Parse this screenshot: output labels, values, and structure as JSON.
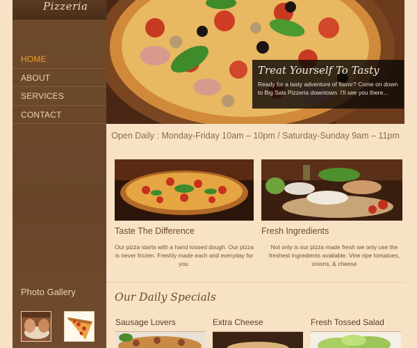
{
  "brand": {
    "logo_text": "Pizzeria"
  },
  "nav": {
    "items": [
      {
        "label": "HOME",
        "active": true
      },
      {
        "label": "ABOUT",
        "active": false
      },
      {
        "label": "SERVICES",
        "active": false
      },
      {
        "label": "CONTACT",
        "active": false
      }
    ]
  },
  "gallery": {
    "title": "Photo Gallery"
  },
  "hero": {
    "caption_title": "Treat Yourself To Tasty",
    "caption_text": "Ready for a tasty adventure of flavor? Come on down to Big Sals Pizzeria downtown. I'll see you there..."
  },
  "hours": {
    "text": "Open Daily : Monday-Friday 10am – 10pm / Saturday-Sunday 9am – 11pm"
  },
  "features": [
    {
      "title": "Taste The Difference",
      "text": "Our pizza starts with a hand tossed dough. Our pizza is never frozen. Freshly made each and everyday for you."
    },
    {
      "title": "Fresh Ingredients",
      "text": "Not only is our pizza made fresh we only use the freshest ingredients available. Vine ripe tomatoes, onions, & cheese"
    }
  ],
  "specials": {
    "title": "Our Daily Specials",
    "items": [
      {
        "label": "Sausage Lovers"
      },
      {
        "label": "Extra Cheese"
      },
      {
        "label": "Fresh Tossed Salad"
      }
    ]
  },
  "colors": {
    "accent": "#f0a12a",
    "sidebar": "#6a4529",
    "page": "#f7e2c6",
    "heading": "#6b4a2c"
  }
}
